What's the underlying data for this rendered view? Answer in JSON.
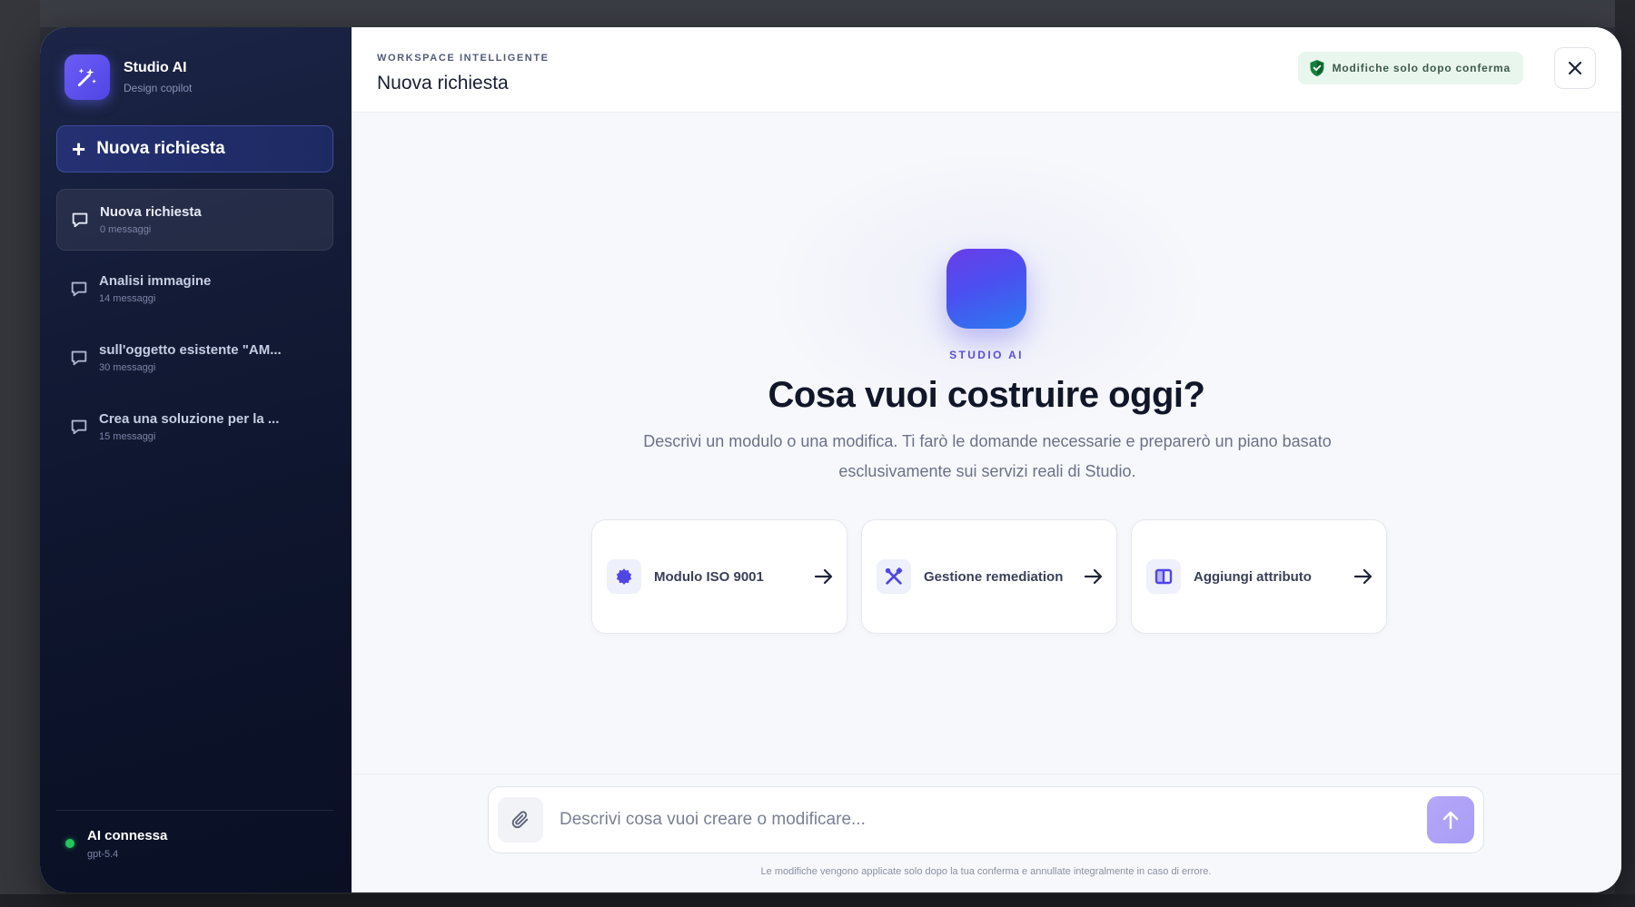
{
  "sidebar": {
    "brand_title": "Studio AI",
    "brand_subtitle": "Design copilot",
    "new_request_label": "Nuova richiesta",
    "conversations": [
      {
        "title": "Nuova richiesta",
        "subtitle": "0 messaggi",
        "active": true
      },
      {
        "title": "Analisi immagine",
        "subtitle": "14 messaggi",
        "active": false
      },
      {
        "title": "sull'oggetto esistente \"AM...",
        "subtitle": "30 messaggi",
        "active": false
      },
      {
        "title": "Crea una soluzione per la ...",
        "subtitle": "15 messaggi",
        "active": false
      }
    ],
    "status": {
      "label": "AI connessa",
      "model": "gpt-5.4",
      "color": "#22c55e"
    }
  },
  "header": {
    "eyebrow": "WORKSPACE INTELLIGENTE",
    "title": "Nuova richiesta",
    "badge_label": "Modifiche solo dopo conferma",
    "badge_icon": "shield-icon",
    "close_icon": "close-icon"
  },
  "hero": {
    "kicker": "STUDIO AI",
    "title": "Cosa vuoi costruire oggi?",
    "description": "Descrivi un modulo o una modifica. Ti farò le domande necessarie e preparerò un piano basato esclusivamente sui servizi reali di Studio."
  },
  "suggestions": [
    {
      "label": "Modulo ISO 9001",
      "icon": "badge-icon"
    },
    {
      "label": "Gestione remediation",
      "icon": "tools-icon"
    },
    {
      "label": "Aggiungi attributo",
      "icon": "columns-icon"
    }
  ],
  "composer": {
    "placeholder": "Descrivi cosa vuoi creare o modificare...",
    "value": "",
    "footnote": "Le modifiche vengono applicate solo dopo la tua conferma e annullate integralmente in caso di errore."
  },
  "colors": {
    "accent": "#4f46e5",
    "sidebar_bg": "#0c132a",
    "status_green": "#22c55e"
  }
}
